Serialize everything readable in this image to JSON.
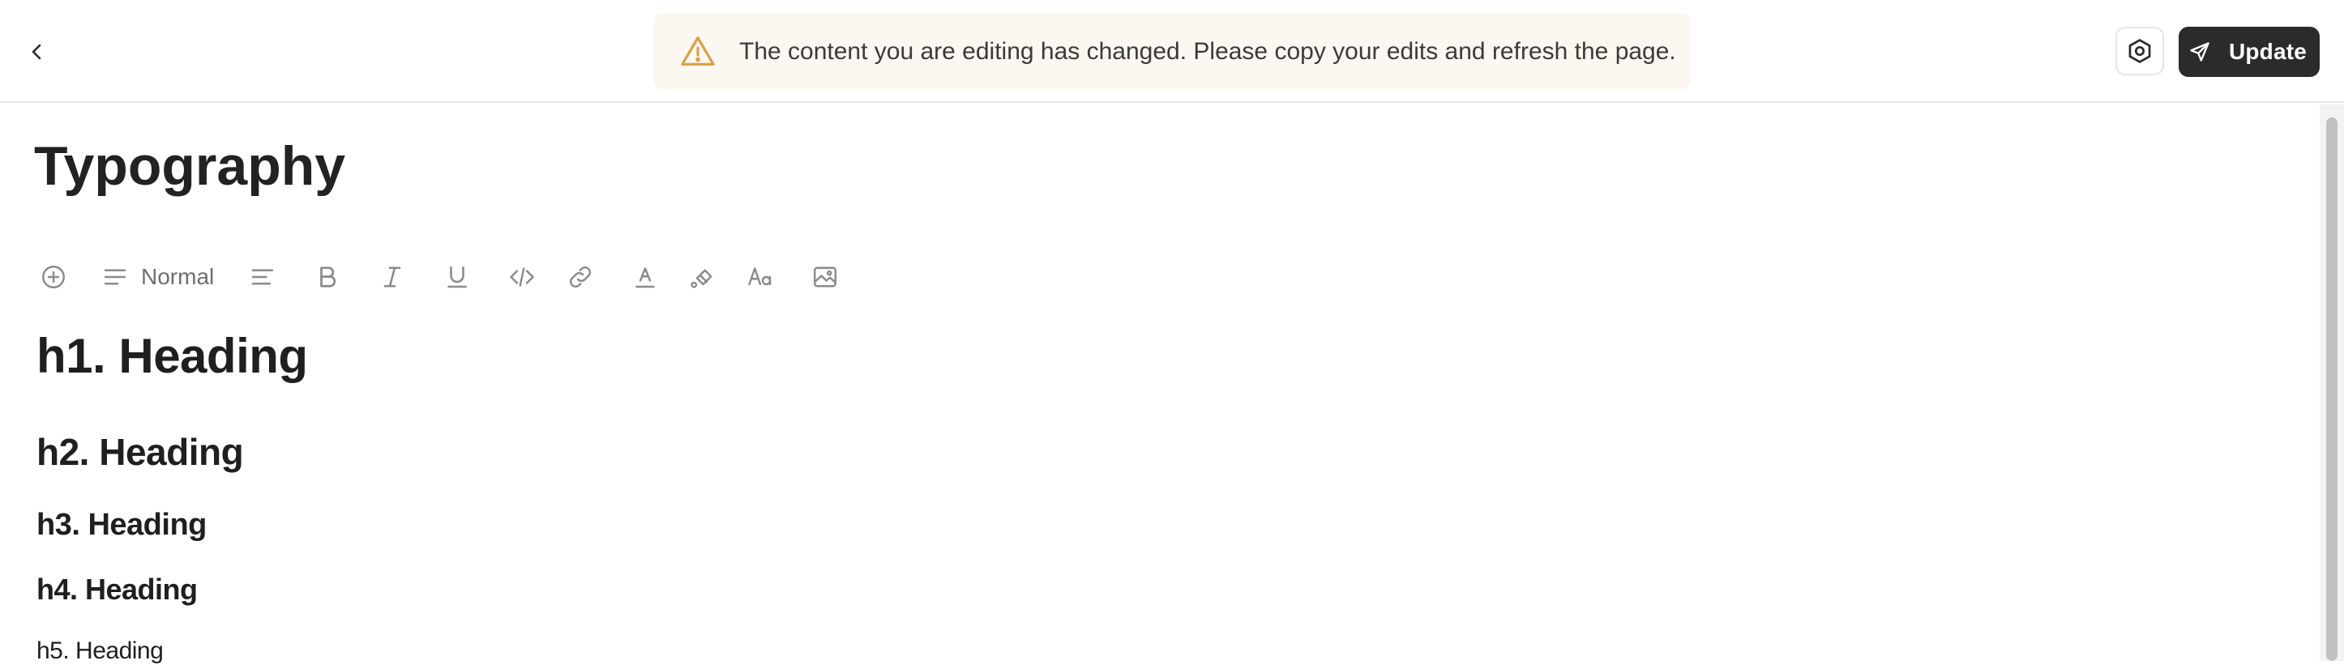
{
  "header": {
    "notice_text": "The content you are editing has changed. Please copy your edits and refresh the page.",
    "update_label": "Update",
    "icons": {
      "back": "chevron-left-icon",
      "warning": "warning-triangle-icon",
      "settings": "settings-hexagon-icon",
      "update": "send-icon"
    },
    "colors": {
      "notice_bg": "#fcf7f1",
      "warning_icon": "#d9a24a",
      "update_bg": "#2b2b2b"
    }
  },
  "document": {
    "title": "Typography",
    "toolbar": {
      "block_style_label": "Normal",
      "items": [
        "add",
        "block-style",
        "align",
        "bold",
        "italic",
        "underline",
        "code",
        "link",
        "text-color",
        "highlight",
        "font-size",
        "image"
      ]
    },
    "headings": {
      "h1": "h1. Heading",
      "h2": "h2. Heading",
      "h3": "h3. Heading",
      "h4": "h4. Heading",
      "h5": "h5. Heading"
    }
  }
}
